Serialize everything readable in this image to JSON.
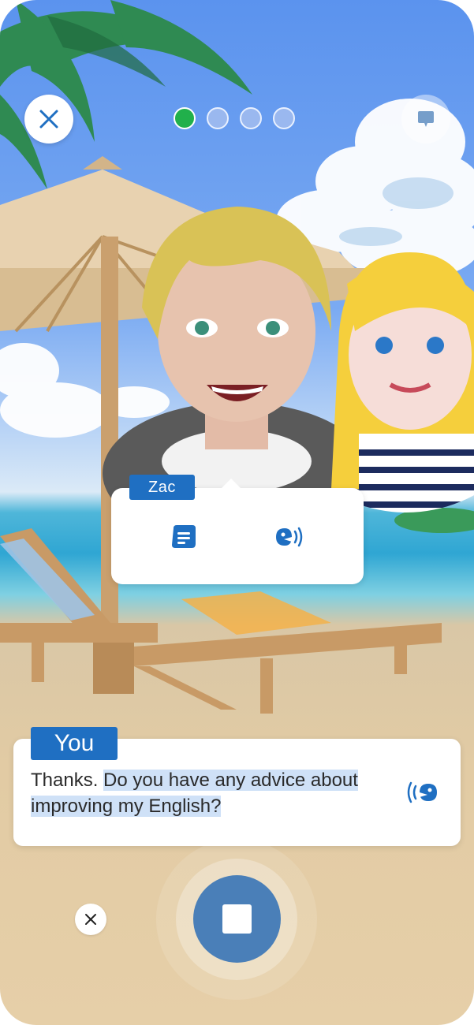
{
  "progress": {
    "steps_total": 4,
    "current_step": 1
  },
  "speaker": {
    "name": "Zac"
  },
  "user": {
    "label": "You",
    "text_plain": "Thanks. ",
    "text_highlight_1": "Do you have any advice about",
    "text_highlight_2": "improving my English?"
  },
  "icons": {
    "close_top": "close-icon",
    "hint": "hint-icon",
    "transcript": "transcript-icon",
    "speaker_audio": "speaker-audio-icon",
    "user_audio": "user-audio-icon",
    "cancel": "small-close-icon",
    "stop": "stop-icon"
  },
  "colors": {
    "accent_blue": "#1f6fc2",
    "record_button": "#4a7fb8",
    "active_dot": "#21b04b",
    "highlight": "#cfe1f7"
  }
}
